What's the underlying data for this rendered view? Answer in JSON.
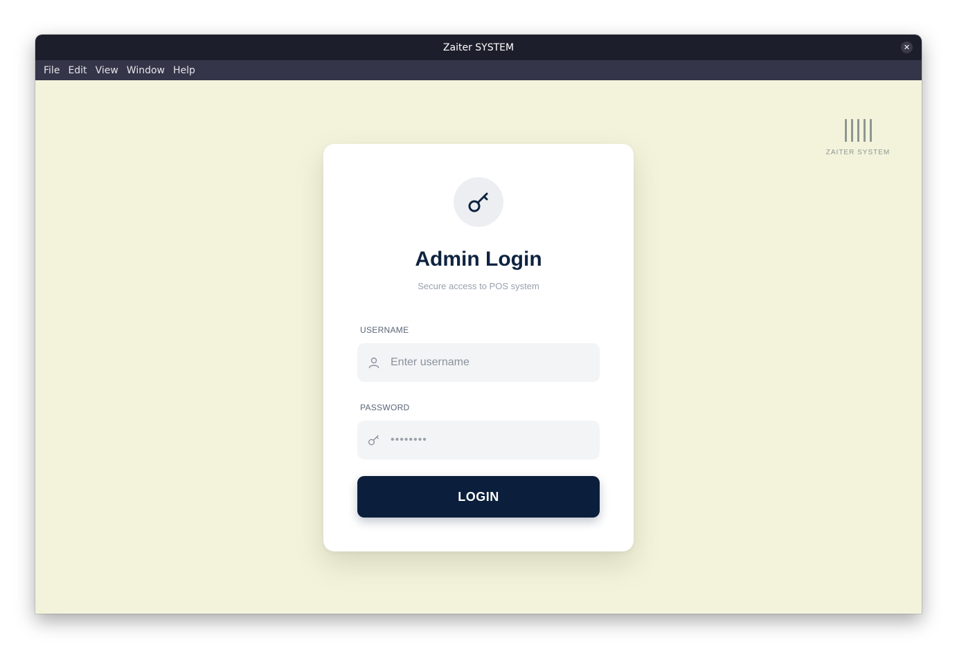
{
  "window": {
    "title": "Zaiter SYSTEM",
    "close_glyph": "✕"
  },
  "menubar": {
    "items": [
      "File",
      "Edit",
      "View",
      "Window",
      "Help"
    ]
  },
  "brand": {
    "logo_text": "ZAITER SYSTEM"
  },
  "login": {
    "icon": "key-icon",
    "title": "Admin Login",
    "subtitle": "Secure access to POS system",
    "username": {
      "label": "USERNAME",
      "placeholder": "Enter username",
      "value": "",
      "icon": "user-icon"
    },
    "password": {
      "label": "PASSWORD",
      "value": "••••••••",
      "icon": "key-icon"
    },
    "button_label": "LOGIN"
  },
  "colors": {
    "background": "#f3f3dc",
    "titlebar": "#1d1e2b",
    "menubar": "#343548",
    "primary": "#0b1e3c",
    "card": "#ffffff",
    "input_bg": "#f3f4f6"
  }
}
